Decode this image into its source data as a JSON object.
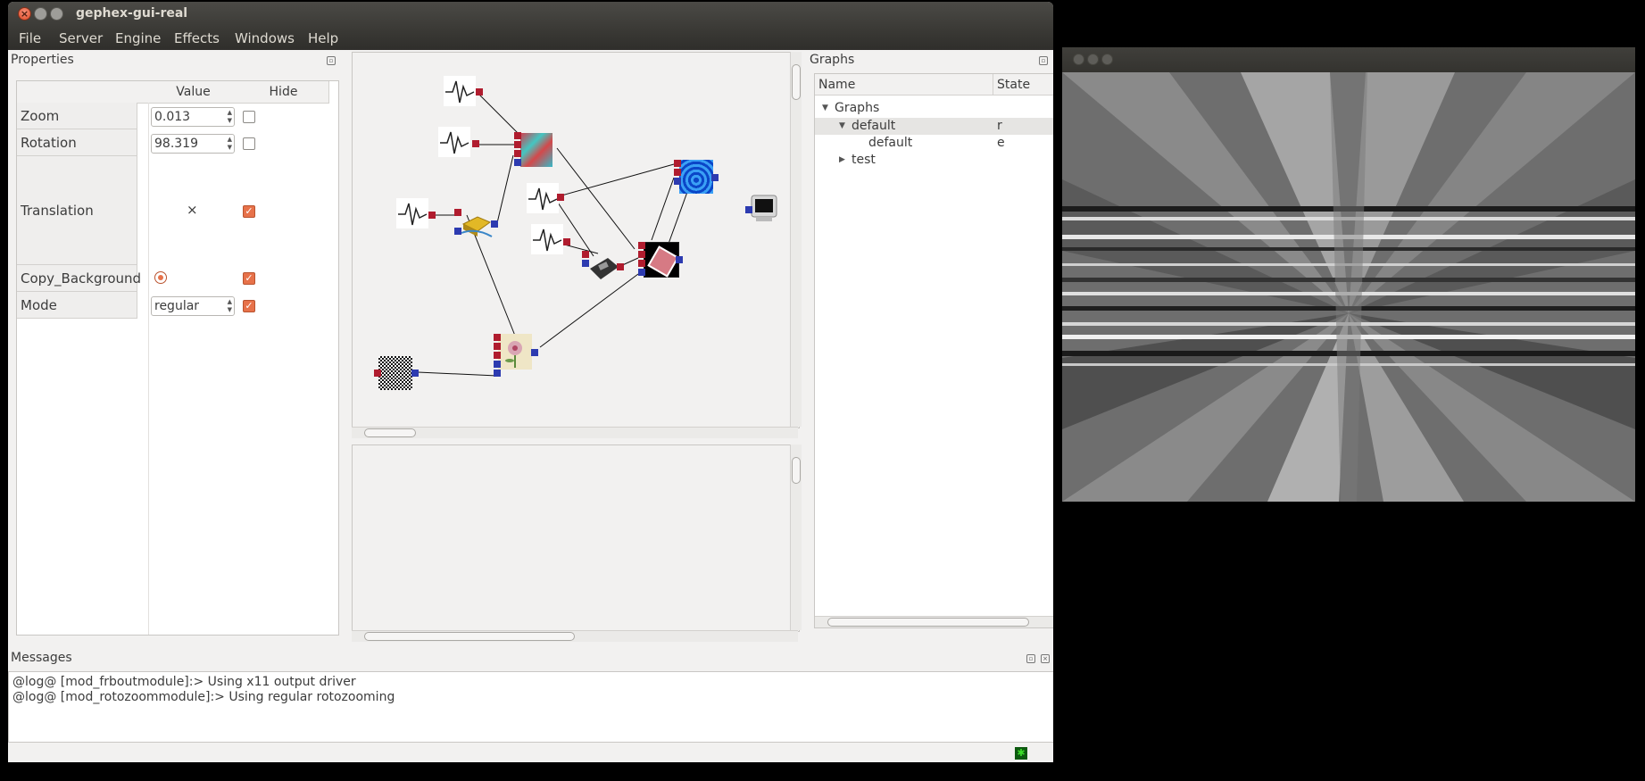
{
  "window": {
    "title": "gephex-gui-real"
  },
  "menubar": {
    "items": [
      {
        "label": "File"
      },
      {
        "label": "Server"
      },
      {
        "label": "Engine"
      },
      {
        "label": "Effects"
      },
      {
        "label": "Windows"
      },
      {
        "label": "Help"
      }
    ]
  },
  "properties": {
    "title": "Properties",
    "columns": [
      "",
      "Value",
      "Hide"
    ],
    "rows": [
      {
        "label": "Zoom",
        "value": "0.013",
        "control": "spinbox",
        "hide": false
      },
      {
        "label": "Rotation",
        "value": "98.319",
        "control": "spinbox",
        "hide": false
      },
      {
        "label": "Translation",
        "value": "×",
        "control": "position",
        "hide": true
      },
      {
        "label": "Copy_Background",
        "value": "",
        "control": "radio",
        "hide": true
      },
      {
        "label": "Mode",
        "value": "regular",
        "control": "combo",
        "hide": true
      }
    ]
  },
  "graph_editor": {
    "nodes": [
      {
        "name": "signal-node-1",
        "icon": "waveform-icon"
      },
      {
        "name": "signal-node-2",
        "icon": "waveform-icon"
      },
      {
        "name": "signal-node-3",
        "icon": "waveform-icon"
      },
      {
        "name": "signal-node-4",
        "icon": "waveform-icon"
      },
      {
        "name": "signal-node-5",
        "icon": "waveform-icon"
      },
      {
        "name": "plasma-node",
        "icon": "plasma-icon"
      },
      {
        "name": "tunnel-node",
        "icon": "tunnel-icon"
      },
      {
        "name": "sponge-node",
        "icon": "sponge-icon"
      },
      {
        "name": "fax-node",
        "icon": "fax-icon"
      },
      {
        "name": "rotozoom-node",
        "icon": "rotozoom-icon"
      },
      {
        "name": "monitor-node",
        "icon": "monitor-icon"
      },
      {
        "name": "noise-node",
        "icon": "noise-icon"
      },
      {
        "name": "flower-node",
        "icon": "flower-icon"
      }
    ]
  },
  "graphs": {
    "title": "Graphs",
    "columns": [
      "Name",
      "State"
    ],
    "tree": [
      {
        "label": "Graphs",
        "state": "",
        "depth": 0,
        "expanded": true
      },
      {
        "label": "default",
        "state": "r",
        "depth": 1,
        "expanded": true
      },
      {
        "label": "default",
        "state": "e",
        "depth": 2
      },
      {
        "label": "test",
        "state": "",
        "depth": 1,
        "expanded": false
      }
    ]
  },
  "messages": {
    "title": "Messages",
    "lines": [
      "@log@ [mod_frboutmodule]:> Using x11 output driver",
      "@log@ [mod_rotozoommodule]:> Using regular rotozooming"
    ]
  },
  "colors": {
    "input_port": "#b01c2e",
    "output_port": "#2d3bb0",
    "accent_checkbox": "#e7724a",
    "titlebar": "#3c3b37"
  }
}
